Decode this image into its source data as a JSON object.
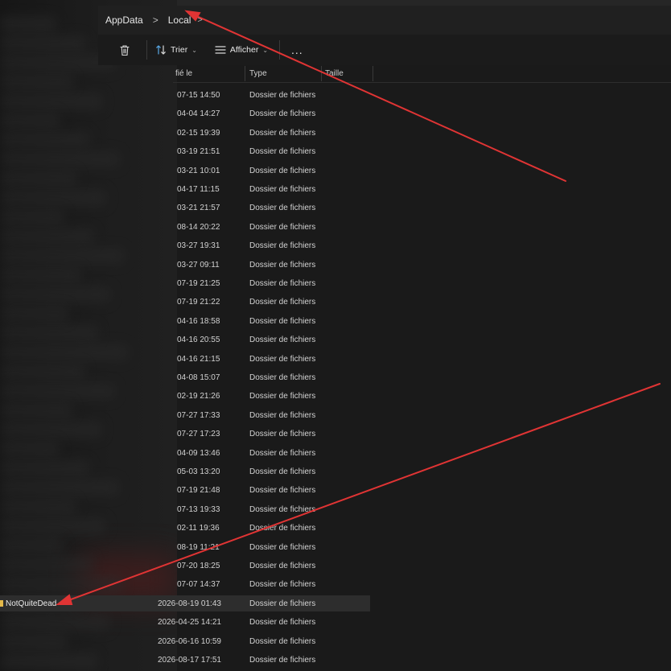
{
  "breadcrumb": {
    "items": [
      "AppData",
      "Local"
    ],
    "separator": ">",
    "expand_glyph": ">"
  },
  "toolbar": {
    "sort_label": "Trier",
    "view_label": "Afficher",
    "more_label": "..."
  },
  "columns": {
    "modified_partial": "fié le",
    "type": "Type",
    "size": "Taille"
  },
  "rows": [
    {
      "date": "07-15 14:50",
      "type": "Dossier de fichiers"
    },
    {
      "date": "04-04 14:27",
      "type": "Dossier de fichiers"
    },
    {
      "date": "02-15 19:39",
      "type": "Dossier de fichiers"
    },
    {
      "date": "03-19 21:51",
      "type": "Dossier de fichiers"
    },
    {
      "date": "03-21 10:01",
      "type": "Dossier de fichiers"
    },
    {
      "date": "04-17 11:15",
      "type": "Dossier de fichiers"
    },
    {
      "date": "03-21 21:57",
      "type": "Dossier de fichiers"
    },
    {
      "date": "08-14 20:22",
      "type": "Dossier de fichiers"
    },
    {
      "date": "03-27 19:31",
      "type": "Dossier de fichiers"
    },
    {
      "date": "03-27 09:11",
      "type": "Dossier de fichiers"
    },
    {
      "date": "07-19 21:25",
      "type": "Dossier de fichiers"
    },
    {
      "date": "07-19 21:22",
      "type": "Dossier de fichiers"
    },
    {
      "date": "04-16 18:58",
      "type": "Dossier de fichiers"
    },
    {
      "date": "04-16 20:55",
      "type": "Dossier de fichiers"
    },
    {
      "date": "04-16 21:15",
      "type": "Dossier de fichiers"
    },
    {
      "date": "04-08 15:07",
      "type": "Dossier de fichiers"
    },
    {
      "date": "02-19 21:26",
      "type": "Dossier de fichiers"
    },
    {
      "date": "07-27 17:33",
      "type": "Dossier de fichiers"
    },
    {
      "date": "07-27 17:23",
      "type": "Dossier de fichiers"
    },
    {
      "date": "04-09 13:46",
      "type": "Dossier de fichiers"
    },
    {
      "date": "05-03 13:20",
      "type": "Dossier de fichiers"
    },
    {
      "date": "07-19 21:48",
      "type": "Dossier de fichiers"
    },
    {
      "date": "07-13 19:33",
      "type": "Dossier de fichiers"
    },
    {
      "date": "02-11 19:36",
      "type": "Dossier de fichiers"
    },
    {
      "date": "08-19 11:21",
      "type": "Dossier de fichiers"
    },
    {
      "date": "07-20 18:25",
      "type": "Dossier de fichiers"
    },
    {
      "date": "07-07 14:37",
      "type": "Dossier de fichiers"
    },
    {
      "date": "2026-08-19 01:43",
      "type": "Dossier de fichiers",
      "name": "NotQuiteDead",
      "selected": true
    },
    {
      "date": "2026-04-25 14:21",
      "type": "Dossier de fichiers"
    },
    {
      "date": "2026-06-16 10:59",
      "type": "Dossier de fichiers"
    },
    {
      "date": "2026-08-17 17:51",
      "type": "Dossier de fichiers"
    }
  ],
  "colors": {
    "background": "#1a1a1a",
    "selected_row": "#2d2d2d",
    "folder": "#e4b94a",
    "annotation_arrow": "#e03434",
    "sort_icon_accent": "#5aa9e6"
  },
  "icons": [
    "trash-icon",
    "sort-icon",
    "view-icon",
    "more-icon",
    "folder-icon"
  ]
}
